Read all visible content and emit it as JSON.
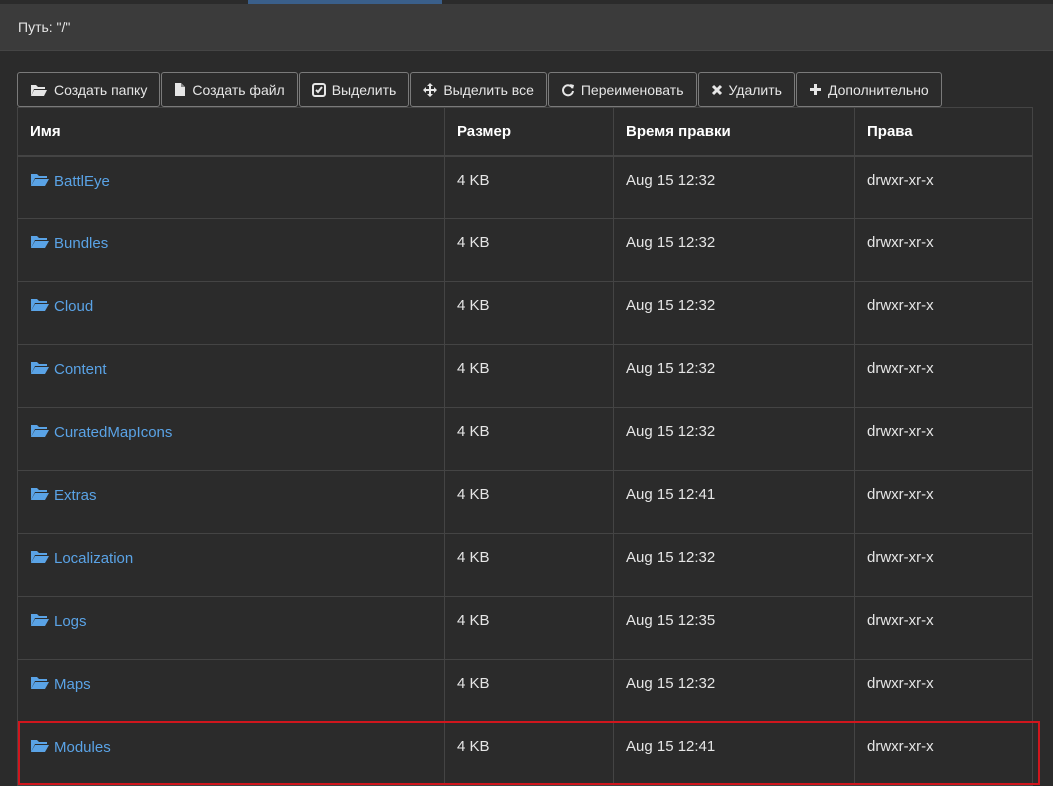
{
  "path_label": "Путь: \"/\"",
  "toolbar": {
    "create_folder": "Создать папку",
    "create_file": "Создать файл",
    "select": "Выделить",
    "select_all": "Выделить все",
    "rename": "Переименовать",
    "delete": "Удалить",
    "more": "Дополнительно"
  },
  "columns": {
    "name": "Имя",
    "size": "Размер",
    "modified": "Время правки",
    "perms": "Права"
  },
  "rows": [
    {
      "name": "BattlEye",
      "size": "4 KB",
      "modified": "Aug 15 12:32",
      "perms": "drwxr-xr-x"
    },
    {
      "name": "Bundles",
      "size": "4 KB",
      "modified": "Aug 15 12:32",
      "perms": "drwxr-xr-x"
    },
    {
      "name": "Cloud",
      "size": "4 KB",
      "modified": "Aug 15 12:32",
      "perms": "drwxr-xr-x"
    },
    {
      "name": "Content",
      "size": "4 KB",
      "modified": "Aug 15 12:32",
      "perms": "drwxr-xr-x"
    },
    {
      "name": "CuratedMapIcons",
      "size": "4 KB",
      "modified": "Aug 15 12:32",
      "perms": "drwxr-xr-x"
    },
    {
      "name": "Extras",
      "size": "4 KB",
      "modified": "Aug 15 12:41",
      "perms": "drwxr-xr-x"
    },
    {
      "name": "Localization",
      "size": "4 KB",
      "modified": "Aug 15 12:32",
      "perms": "drwxr-xr-x"
    },
    {
      "name": "Logs",
      "size": "4 KB",
      "modified": "Aug 15 12:35",
      "perms": "drwxr-xr-x"
    },
    {
      "name": "Maps",
      "size": "4 KB",
      "modified": "Aug 15 12:32",
      "perms": "drwxr-xr-x"
    },
    {
      "name": "Modules",
      "size": "4 KB",
      "modified": "Aug 15 12:41",
      "perms": "drwxr-xr-x"
    }
  ],
  "colors": {
    "link": "#5aa3e6",
    "highlight": "#d0161d",
    "background": "#2b2b2b"
  }
}
